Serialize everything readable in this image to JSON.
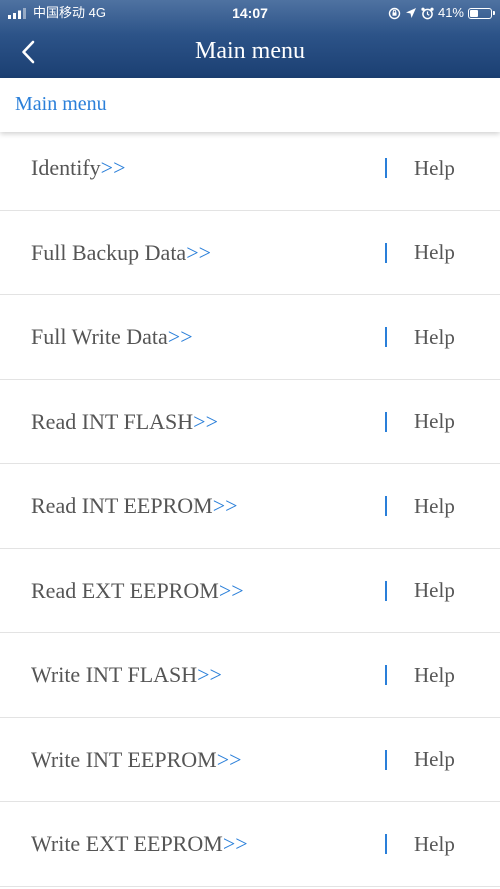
{
  "status_bar": {
    "carrier": "中国移动  4G",
    "time": "14:07",
    "battery_percent": "41%",
    "battery_level": 0.41,
    "icons": [
      "signal-icon",
      "orientation-lock-icon",
      "location-icon",
      "alarm-icon",
      "battery-icon"
    ]
  },
  "nav": {
    "back_icon": "chevron-left-icon",
    "title": "Main menu"
  },
  "breadcrumb": {
    "label": "Main menu"
  },
  "menu": {
    "arrow": ">>",
    "help_label": "Help",
    "items": [
      {
        "label": "Identify"
      },
      {
        "label": "Full Backup Data"
      },
      {
        "label": "Full Write Data"
      },
      {
        "label": "Read INT FLASH"
      },
      {
        "label": "Read INT EEPROM"
      },
      {
        "label": "Read EXT EEPROM"
      },
      {
        "label": "Write INT FLASH"
      },
      {
        "label": "Write INT EEPROM"
      },
      {
        "label": "Write EXT EEPROM"
      }
    ]
  },
  "colors": {
    "header_top": "#4f72a1",
    "header_bottom": "#1b3f72",
    "accent_blue": "#2a7fd9",
    "label_gray": "#555555",
    "divider_gray": "#e3e3e3"
  }
}
